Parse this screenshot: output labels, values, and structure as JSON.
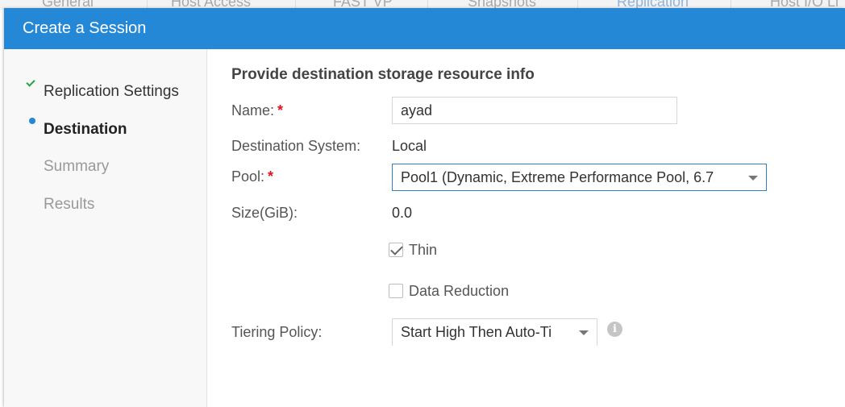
{
  "background_tabs": [
    "General",
    "Host Access",
    "FAST VP",
    "Snapshots",
    "Replication",
    "Host I/O Li"
  ],
  "dialog": {
    "title": "Create a Session"
  },
  "steps": [
    {
      "label": "Replication Settings",
      "state": "done"
    },
    {
      "label": "Destination",
      "state": "current"
    },
    {
      "label": "Summary",
      "state": "pending"
    },
    {
      "label": "Results",
      "state": "pending"
    }
  ],
  "form": {
    "heading": "Provide destination storage resource info",
    "required_marker": "*",
    "name": {
      "label": "Name:",
      "value": "ayad"
    },
    "destination_system": {
      "label": "Destination System:",
      "value": "Local"
    },
    "pool": {
      "label": "Pool:",
      "selected": "Pool1 (Dynamic, Extreme Performance Pool, 6.7"
    },
    "size": {
      "label": "Size(GiB):",
      "value": "0.0"
    },
    "thin": {
      "label": "Thin",
      "checked": true
    },
    "data_reduction": {
      "label": "Data Reduction",
      "checked": false
    },
    "tiering_policy": {
      "label": "Tiering Policy:",
      "selected": "Start High Then Auto-Ti"
    }
  },
  "icons": {
    "info": "info-icon",
    "done_step": "check-icon",
    "current_step": "dot-icon",
    "dropdown": "chevron-down-icon"
  },
  "colors": {
    "titlebar": "#2588d6",
    "required": "#e0141e",
    "done_check": "#2aa33f",
    "focus_border": "#2f7ec8"
  }
}
